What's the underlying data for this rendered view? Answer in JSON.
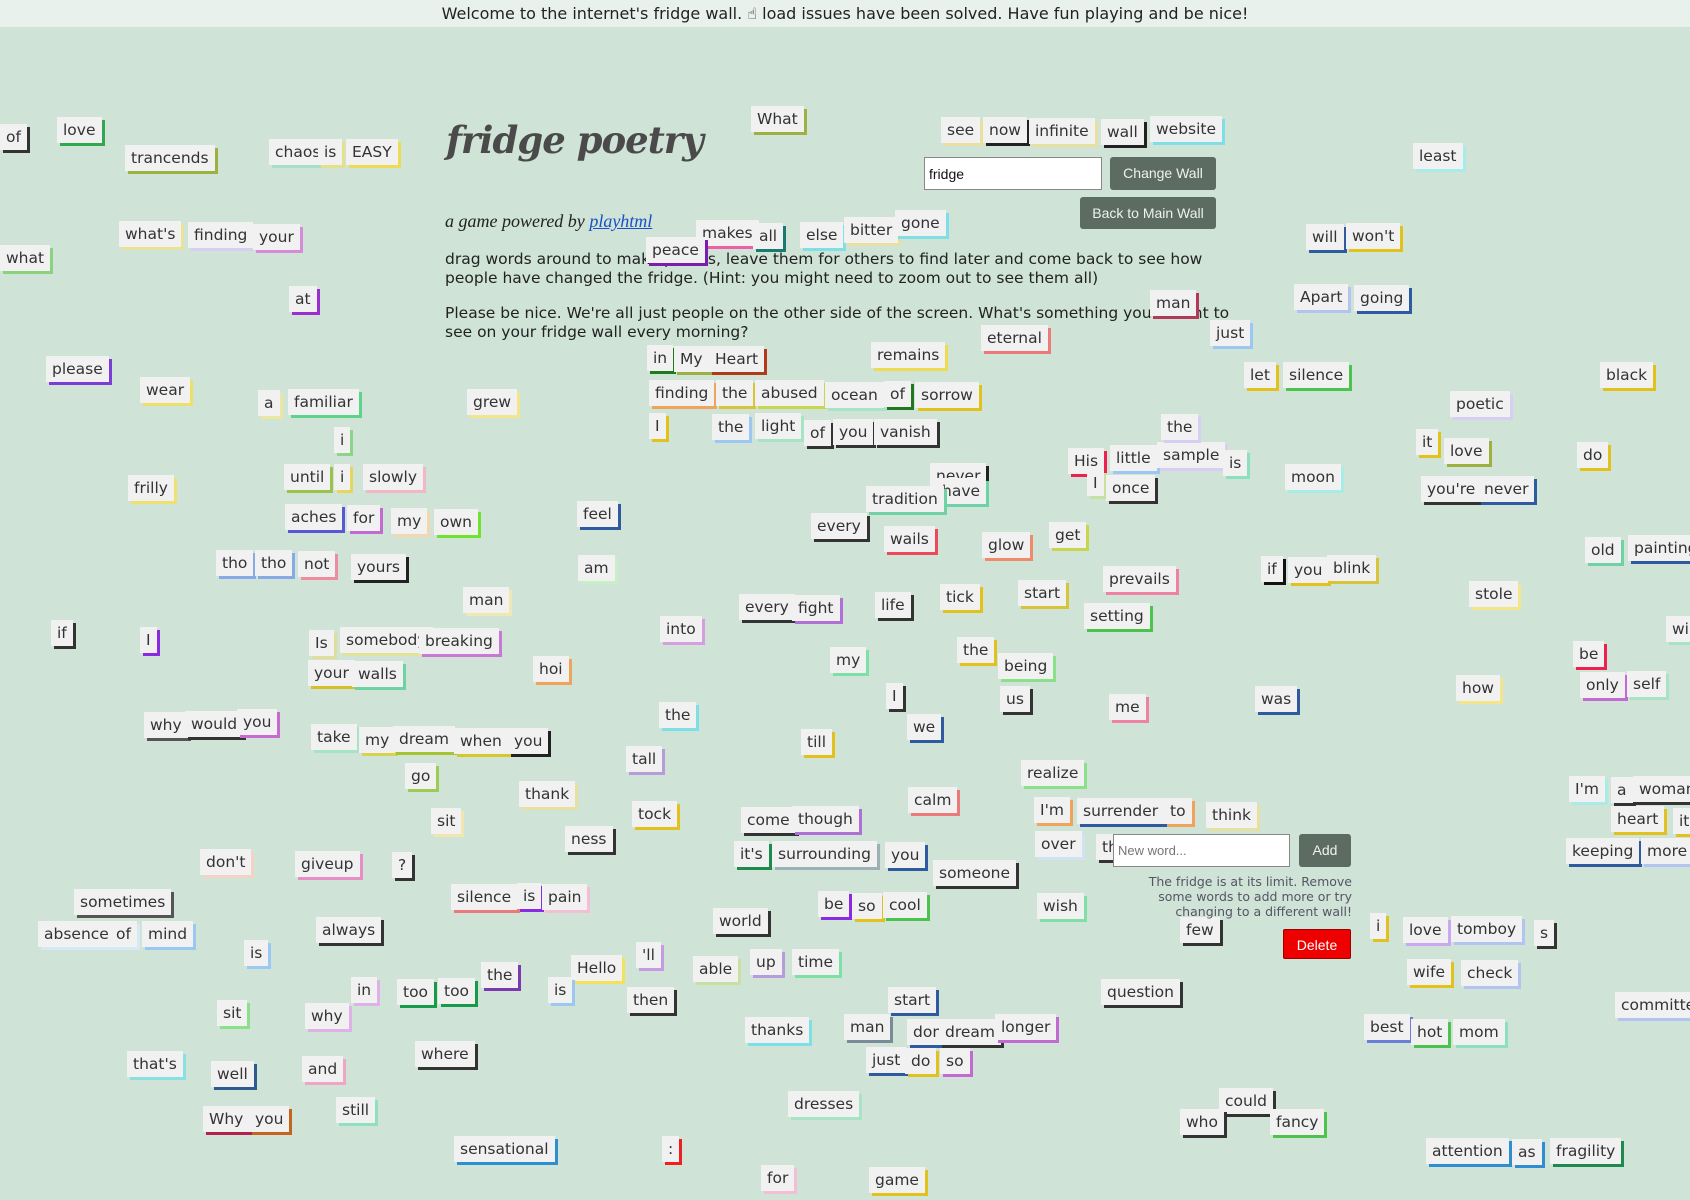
{
  "banner": "Welcome to the internet's fridge wall. ☝ load issues have been solved. Have fun playing and be nice!",
  "header": {
    "title": "fridge poetry",
    "subtitle_prefix": "a game powered by",
    "subtitle_link": "playhtml",
    "para1": "drag words around to make poems, leave them for others to find later and come back to see how people have changed the fridge. (Hint: you might need to zoom out to see them all)",
    "para2": "Please be nice. We're all just people on the other side of the screen. What's something you'd want to see on your fridge wall every morning?"
  },
  "wall_controls": {
    "wall_input_value": "fridge",
    "change_wall": "Change Wall",
    "back_to_main": "Back to Main Wall"
  },
  "add_controls": {
    "new_word_placeholder": "New word...",
    "add": "Add",
    "limit_note": "The fridge is at its limit. Remove some words to add more or try changing to a different wall!",
    "delete": "Delete"
  },
  "colors": {
    "background": "#cfe3d6",
    "tile": "#f1f1f1",
    "button": "#5c6c63",
    "delete": "#ee0000"
  },
  "words": [
    "of",
    "love",
    "trancends",
    "chaos",
    "is",
    "EASY",
    "what's",
    "finding",
    "your",
    "what",
    "at",
    "please",
    "wear",
    "a",
    "familiar",
    "grew",
    "i",
    "until",
    "i",
    "slowly",
    "frilly",
    "aches",
    "for",
    "my",
    "own",
    "tho",
    "tho",
    "not",
    "yours",
    "man",
    "if",
    "I",
    "Is",
    "somebody",
    "breaking",
    "your",
    "walls",
    "why",
    "would",
    "you",
    "take",
    "my",
    "dream",
    "when",
    "you",
    "go",
    "sit",
    "don't",
    "giveup",
    "?",
    "sometimes",
    "absence",
    "of",
    "mind",
    "always",
    "is",
    "sit",
    "why",
    "in",
    "too",
    "too",
    "the",
    "that's",
    "well",
    "and",
    "where",
    "Why",
    "you",
    "still",
    "sensational",
    "silence",
    "is",
    "pain",
    "hoi",
    "thank",
    "ness",
    "feel",
    "am",
    "into",
    "the",
    "tall",
    "tock",
    "Hello",
    "is",
    "'ll",
    "then",
    "What",
    "makes",
    "peace",
    "all",
    "else",
    "bitter",
    "gone",
    "in",
    "My",
    "Heart",
    "finding",
    "the",
    "abused",
    "ocean",
    "of",
    "sorrow",
    "I",
    "the",
    "light",
    "of",
    "you",
    "vanish",
    "remains",
    "eternal",
    "see",
    "now",
    "infinite",
    "wall",
    "website",
    "never",
    "have",
    "tradition",
    "every",
    "wails",
    "glow",
    "get",
    "every",
    "fight",
    "life",
    "tick",
    "start",
    "prevails",
    "setting",
    "my",
    "the",
    "being",
    "I",
    "we",
    "us",
    "me",
    "till",
    "realize",
    "come",
    "though",
    "calm",
    "I'm",
    "surrender",
    "to",
    "think",
    "it's",
    "surrounding",
    "you",
    "over",
    "the",
    "someone",
    "be",
    "so",
    "cool",
    "wish",
    "world",
    "able",
    "up",
    "time",
    "start",
    "thanks",
    "man",
    "dont",
    "dream",
    "longer",
    "just",
    "do",
    "so",
    "question",
    "dresses",
    "could",
    "who",
    "fancy",
    ":",
    "for",
    "game",
    "few",
    "man",
    "just",
    "His",
    "little",
    "sample",
    "is",
    "I",
    "once",
    "the",
    "will",
    "won't",
    "Apart",
    "going",
    "let",
    "silence",
    "moon",
    "least",
    "poetic",
    "black",
    "it",
    "love",
    "you're",
    "never",
    "do",
    "if",
    "you",
    "blink",
    "stole",
    "old",
    "painting",
    "be",
    "only",
    "self",
    "how",
    "was",
    "I'm",
    "a",
    "woman",
    "heart",
    "it",
    "keeping",
    "more",
    "i",
    "love",
    "tomboy",
    "s",
    "wife",
    "check",
    "best",
    "hot",
    "mom",
    "committe",
    "attention",
    "as",
    "fragility",
    "wi"
  ]
}
